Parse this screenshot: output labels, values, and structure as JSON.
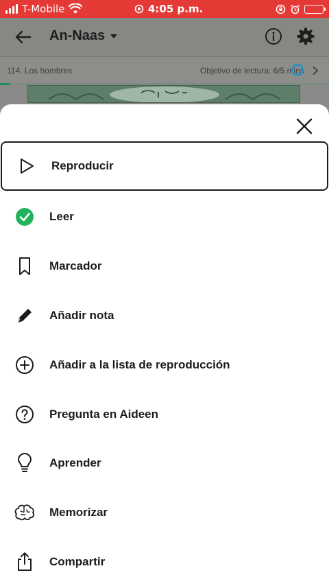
{
  "status_bar": {
    "carrier": "T-Mobile",
    "time": "4:05 p.m."
  },
  "header": {
    "title": "An-Naas"
  },
  "sub_bar": {
    "surah_label": "114. Los hombres",
    "goal_label": "Objetivo de lectura: 6/5 mins"
  },
  "reading_progress": 0.03,
  "menu": {
    "items": [
      {
        "label": "Reproducir",
        "icon": "play-icon"
      },
      {
        "label": "Leer",
        "icon": "check-circle-icon"
      },
      {
        "label": "Marcador",
        "icon": "bookmark-icon"
      },
      {
        "label": "Añadir nota",
        "icon": "pencil-icon"
      },
      {
        "label": "Añadir a la lista de reproducción",
        "icon": "plus-circle-icon"
      },
      {
        "label": "Pregunta en Aideen",
        "icon": "question-circle-icon"
      },
      {
        "label": "Aprender",
        "icon": "lightbulb-icon"
      },
      {
        "label": "Memorizar",
        "icon": "brain-icon"
      },
      {
        "label": "Compartir",
        "icon": "share-icon"
      }
    ]
  },
  "colors": {
    "status_bar": "#e53935",
    "check": "#22b35e",
    "goal_ring": "#2e8fc1"
  }
}
